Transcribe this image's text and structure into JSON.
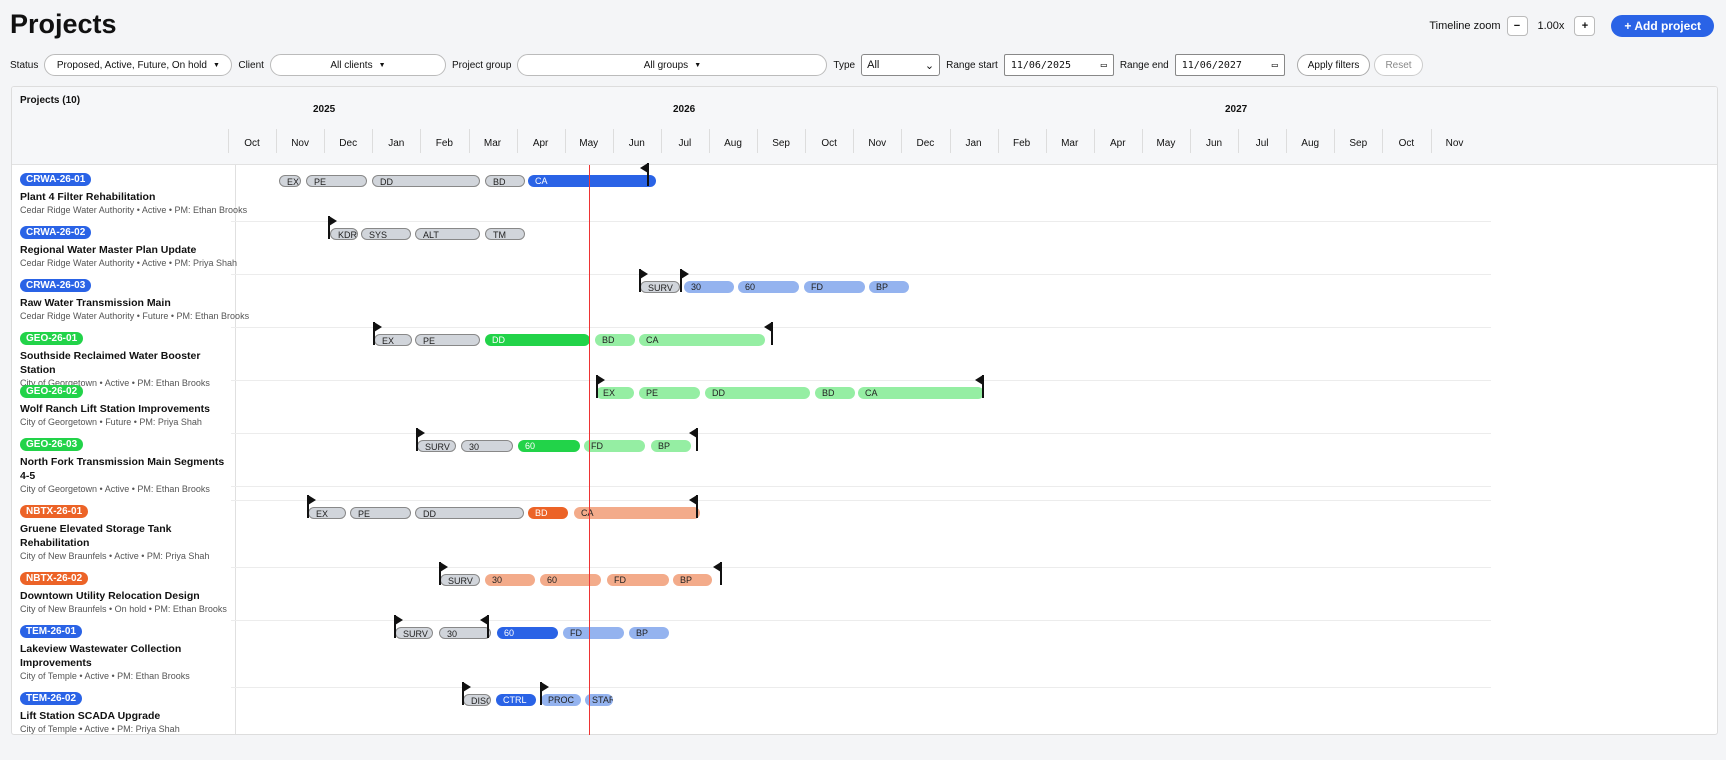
{
  "header": {
    "title": "Projects"
  },
  "zoom": {
    "label": "Timeline zoom",
    "minus": "−",
    "value": "1.00x",
    "plus": "+"
  },
  "add_button": "+ Add project",
  "filters": {
    "status_label": "Status",
    "status_value": "Proposed, Active, Future, On hold",
    "client_label": "Client",
    "client_value": "All clients",
    "group_label": "Project group",
    "group_value": "All groups",
    "type_label": "Type",
    "type_value": "All",
    "range_start_label": "Range start",
    "range_start_value": "11/06/2025",
    "range_end_label": "Range end",
    "range_end_value": "11/06/2027",
    "apply": "Apply filters",
    "reset": "Reset"
  },
  "panel": {
    "count_label": "Projects (10)"
  },
  "colors": {
    "blue": "#2a63e6",
    "green": "#22d349",
    "orange": "#ec6327",
    "gray": "#d1d5db",
    "light_blue": "#94b3ef",
    "light_green": "#95eea3",
    "light_orange": "#f3ab8a",
    "today": "#e33333"
  },
  "timeline": {
    "years": [
      "2025",
      "2026",
      "2027"
    ],
    "months": [
      "Oct",
      "Nov",
      "Dec",
      "Jan",
      "Feb",
      "Mar",
      "Apr",
      "May",
      "Jun",
      "Jul",
      "Aug",
      "Sep",
      "Oct",
      "Nov",
      "Dec",
      "Jan",
      "Feb",
      "Mar",
      "Apr",
      "May",
      "Jun",
      "Jul",
      "Aug",
      "Sep",
      "Oct",
      "Nov"
    ]
  },
  "projects": [
    {
      "code": "CRWA-26-01",
      "name": "Plant 4 Filter Rehabilitation",
      "meta": "Cedar Ridge Water Authority • Active • PM: Ethan Brooks"
    },
    {
      "code": "CRWA-26-02",
      "name": "Regional Water Master Plan Update",
      "meta": "Cedar Ridge Water Authority • Active • PM: Priya Shah"
    },
    {
      "code": "CRWA-26-03",
      "name": "Raw Water Transmission Main",
      "meta": "Cedar Ridge Water Authority • Future • PM: Ethan Brooks"
    },
    {
      "code": "GEO-26-01",
      "name": "Southside Reclaimed Water Booster Station",
      "meta": "City of Georgetown • Active • PM: Ethan Brooks"
    },
    {
      "code": "GEO-26-02",
      "name": "Wolf Ranch Lift Station Improvements",
      "meta": "City of Georgetown • Future • PM: Priya Shah"
    },
    {
      "code": "GEO-26-03",
      "name": "North Fork Transmission Main Segments 4-5",
      "meta": "City of Georgetown • Active • PM: Ethan Brooks"
    },
    {
      "code": "NBTX-26-01",
      "name": "Gruene Elevated Storage Tank Rehabilitation",
      "meta": "City of New Braunfels • Active • PM: Priya Shah"
    },
    {
      "code": "NBTX-26-02",
      "name": "Downtown Utility Relocation Design",
      "meta": "City of New Braunfels • On hold • PM: Ethan Brooks"
    },
    {
      "code": "TEM-26-01",
      "name": "Lakeview Wastewater Collection Improvements",
      "meta": "City of Temple • Active • PM: Ethan Brooks"
    },
    {
      "code": "TEM-26-02",
      "name": "Lift Station SCADA Upgrade",
      "meta": "City of Temple • Active • PM: Priya Shah"
    }
  ],
  "phases": [
    [
      "EX",
      "PE",
      "DD",
      "BD",
      "CA"
    ],
    [
      "KDR",
      "SYS",
      "ALT",
      "TM"
    ],
    [
      "SURV",
      "30",
      "60",
      "FD",
      "BP"
    ],
    [
      "EX",
      "PE",
      "DD",
      "BD",
      "CA"
    ],
    [
      "EX",
      "PE",
      "DD",
      "BD",
      "CA"
    ],
    [
      "SURV",
      "30",
      "60",
      "FD",
      "BP"
    ],
    [
      "EX",
      "PE",
      "DD",
      "BD",
      "CA"
    ],
    [
      "SURV",
      "30",
      "60",
      "FD",
      "BP"
    ],
    [
      "SURV",
      "30",
      "60",
      "FD",
      "BP"
    ],
    [
      "DISC",
      "CTRL",
      "PROC",
      "START"
    ]
  ]
}
